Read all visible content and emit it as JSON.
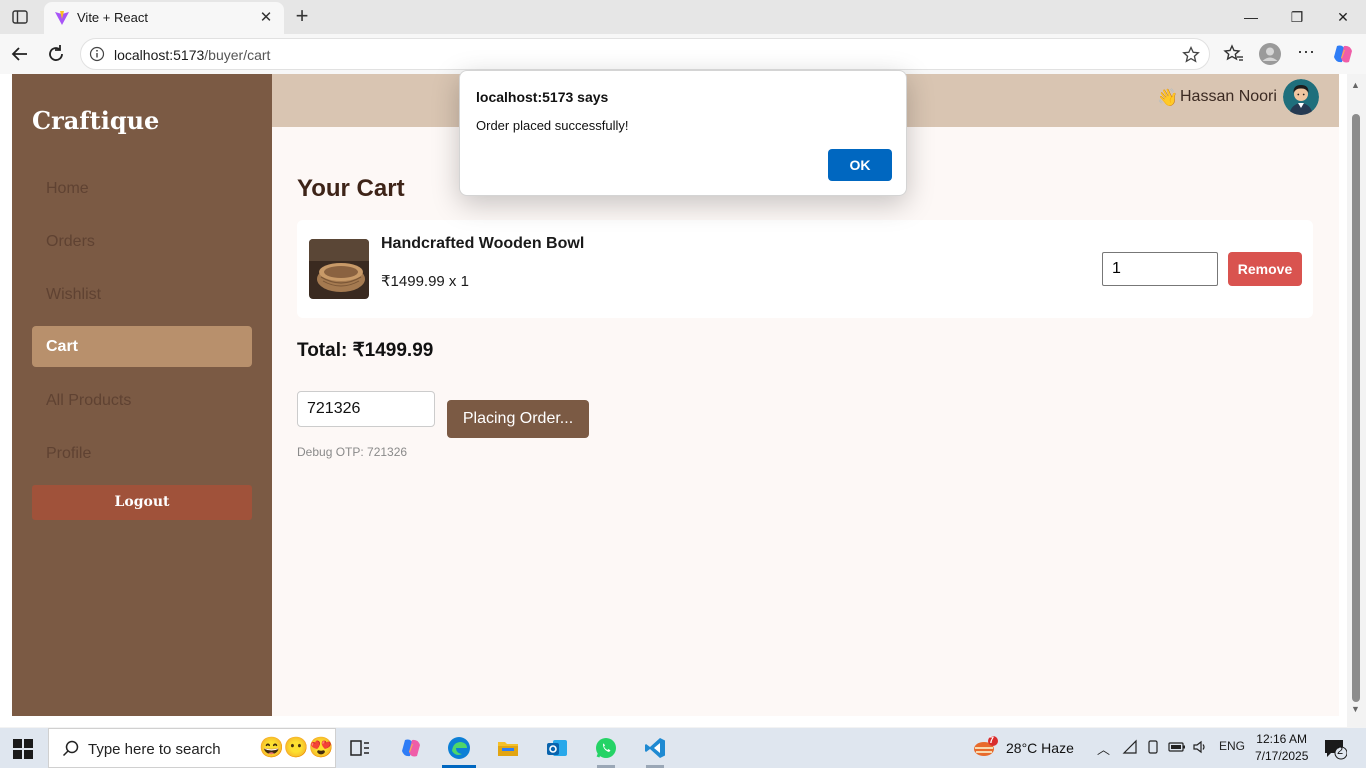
{
  "browser": {
    "tab_title": "Vite + React",
    "url_host": "localhost:5173",
    "url_path": "/buyer/cart"
  },
  "sidebar": {
    "brand": "Craftique",
    "items": [
      {
        "label": "Home"
      },
      {
        "label": "Orders"
      },
      {
        "label": "Wishlist"
      },
      {
        "label": "Cart"
      },
      {
        "label": "All Products"
      },
      {
        "label": "Profile"
      }
    ],
    "active_item": "Cart",
    "logout_label": "Logout"
  },
  "header": {
    "wave_emoji": "👋",
    "user_name": "Hassan Noori"
  },
  "cart": {
    "title": "Your Cart",
    "items": [
      {
        "name": "Handcrafted Wooden Bowl",
        "price_line": "₹1499.99 x 1",
        "quantity": "1",
        "remove_label": "Remove"
      }
    ],
    "total": "Total: ₹1499.99",
    "otp_value": "721326",
    "place_order_label": "Placing Order...",
    "debug_otp": "Debug OTP: 721326"
  },
  "dialog": {
    "title": "localhost:5173 says",
    "message": "Order placed successfully!",
    "ok_label": "OK"
  },
  "taskbar": {
    "search_placeholder": "Type here to search",
    "weather_badge": "7",
    "weather": "28°C  Haze",
    "language": "ENG",
    "time": "12:16 AM",
    "date": "7/17/2025",
    "notification_count": "2"
  },
  "colors": {
    "sidebar": "#7b5a44",
    "sidebar_active": "#b8906c",
    "logout": "#a0523a",
    "topbar": "#d9c5b2",
    "remove": "#d9534f",
    "ok_button": "#0067c0"
  }
}
